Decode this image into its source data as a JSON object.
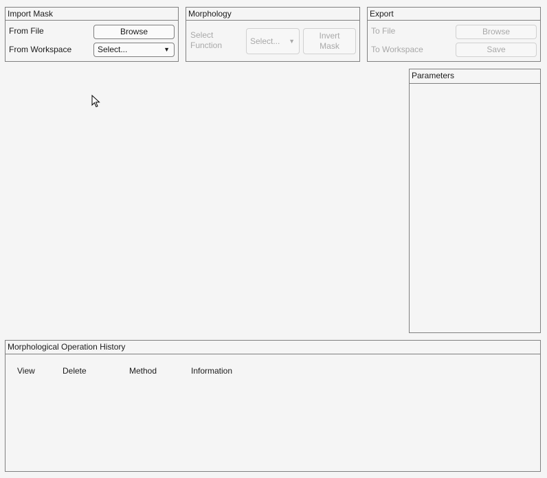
{
  "import_mask": {
    "title": "Import Mask",
    "from_file_label": "From File",
    "browse_label": "Browse",
    "from_workspace_label": "From Workspace",
    "workspace_select_value": "Select..."
  },
  "morphology": {
    "title": "Morphology",
    "select_function_label_line1": "Select",
    "select_function_label_line2": "Function",
    "function_select_value": "Select...",
    "invert_mask_line1": "Invert",
    "invert_mask_line2": "Mask"
  },
  "export": {
    "title": "Export",
    "to_file_label": "To File",
    "browse_label": "Browse",
    "to_workspace_label": "To Workspace",
    "save_label": "Save"
  },
  "parameters": {
    "title": "Parameters"
  },
  "history": {
    "title": "Morphological Operation History",
    "columns": [
      "View",
      "Delete",
      "Method",
      "Information"
    ]
  },
  "icons": {
    "dropdown_caret": "▼",
    "cursor": "mouse-pointer-icon"
  }
}
